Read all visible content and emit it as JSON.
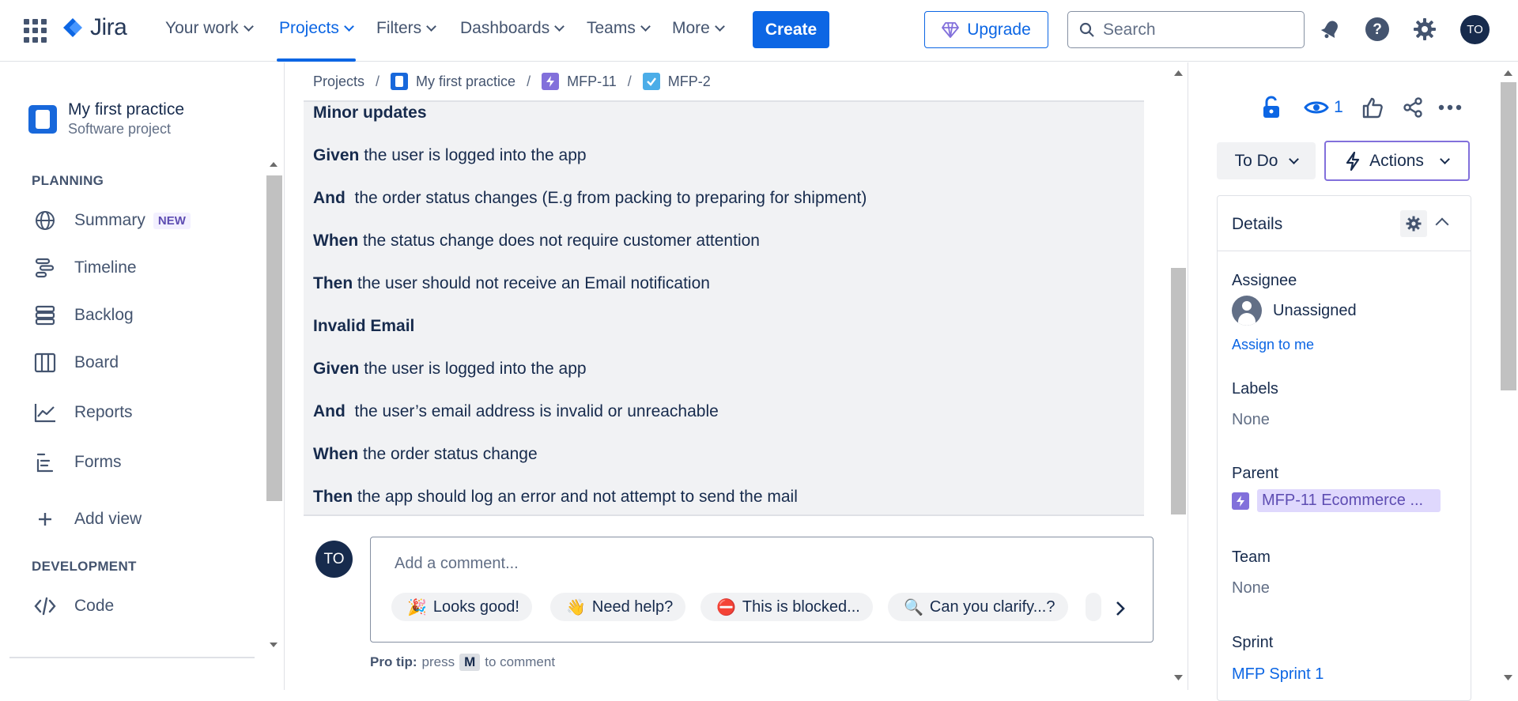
{
  "topnav": {
    "logo": "Jira",
    "items": [
      "Your work",
      "Projects",
      "Filters",
      "Dashboards",
      "Teams",
      "More"
    ],
    "create": "Create",
    "upgrade": "Upgrade",
    "search_placeholder": "Search",
    "avatar": "TO"
  },
  "sidebar": {
    "project_name": "My first practice",
    "project_type": "Software project",
    "planning_label": "PLANNING",
    "items": [
      {
        "label": "Summary",
        "badge": "NEW"
      },
      {
        "label": "Timeline"
      },
      {
        "label": "Backlog"
      },
      {
        "label": "Board"
      },
      {
        "label": "Reports"
      },
      {
        "label": "Forms"
      }
    ],
    "add_view": "Add view",
    "development_label": "DEVELOPMENT",
    "code": "Code"
  },
  "breadcrumb": [
    "Projects",
    "My first practice",
    "MFP-11",
    "MFP-2"
  ],
  "description": [
    {
      "bold": "Minor updates",
      "text": ""
    },
    {
      "bold": "Given",
      "text": " the user is logged into the app"
    },
    {
      "bold": "And",
      "text": "  the order status changes (E.g from packing to preparing for shipment)"
    },
    {
      "bold": "When",
      "text": " the status change does not require customer attention"
    },
    {
      "bold": "Then",
      "text": " the user should not receive an Email notification"
    },
    {
      "bold": "Invalid Email",
      "text": ""
    },
    {
      "bold": "Given",
      "text": " the user is logged into the app"
    },
    {
      "bold": "And",
      "text": "  the user’s email address is invalid or unreachable"
    },
    {
      "bold": "When",
      "text": " the order status change"
    },
    {
      "bold": "Then",
      "text": " the app should log an error and not attempt to send the mail"
    }
  ],
  "comment": {
    "avatar": "TO",
    "placeholder": "Add a comment...",
    "chips": [
      {
        "emoji": "🎉",
        "label": "Looks good!"
      },
      {
        "emoji": "👋",
        "label": "Need help?"
      },
      {
        "emoji": "⛔",
        "label": "This is blocked..."
      },
      {
        "emoji": "🔍",
        "label": "Can you clarify...?"
      }
    ],
    "protip_label": "Pro tip:",
    "protip_press": "press",
    "protip_key": "M",
    "protip_rest": "to comment"
  },
  "right_panel": {
    "watchers": "1",
    "status": "To Do",
    "actions": "Actions",
    "details_title": "Details",
    "assignee_label": "Assignee",
    "assignee_value": "Unassigned",
    "assign_to_me": "Assign to me",
    "labels_label": "Labels",
    "labels_value": "None",
    "parent_label": "Parent",
    "parent_value": "MFP-11 Ecommerce ...",
    "team_label": "Team",
    "team_value": "None",
    "sprint_label": "Sprint",
    "sprint_value": "MFP Sprint 1"
  },
  "colors": {
    "primary": "#0c66e4",
    "epic": "#8270db",
    "task": "#4bade8",
    "text": "#172b4d"
  }
}
